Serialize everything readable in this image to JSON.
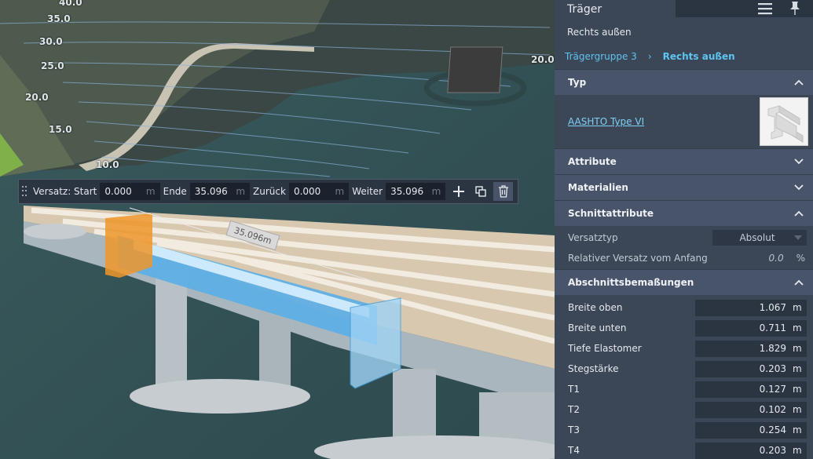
{
  "viewport": {
    "contour_labels": [
      "40.0",
      "35.0",
      "30.0",
      "25.0",
      "20.0",
      "15.0",
      "10.0",
      "20.0"
    ],
    "dimension_label": "35.096m"
  },
  "toolbar": {
    "start_label": "Versatz: Start",
    "start_value": "0.000",
    "end_label": "Ende",
    "end_value": "35.096",
    "back_label": "Zurück",
    "back_value": "0.000",
    "forward_label": "Weiter",
    "forward_value": "35.096",
    "unit": "m",
    "icons": [
      "plus-icon",
      "copy-icon",
      "trash-icon"
    ]
  },
  "panel": {
    "tab_title": "Träger",
    "subtitle": "Rechts außen",
    "breadcrumb": [
      {
        "label": "Trägergruppe 3"
      },
      {
        "label": "Rechts außen"
      }
    ],
    "sections": {
      "type": {
        "title": "Typ",
        "link": "AASHTO Type VI"
      },
      "attributes": {
        "title": "Attribute"
      },
      "materials": {
        "title": "Materialien"
      },
      "cross_section": {
        "title": "Schnittattribute",
        "offset_type_label": "Versatztyp",
        "offset_type_value": "Absolut",
        "relative_offset_label": "Relativer Versatz vom Anfang",
        "relative_offset_value": "0.0",
        "relative_offset_unit": "%"
      },
      "dimensions": {
        "title": "Abschnittsbemaßungen",
        "unit": "m",
        "rows": [
          {
            "label": "Breite oben",
            "value": "1.067"
          },
          {
            "label": "Breite unten",
            "value": "0.711"
          },
          {
            "label": "Tiefe Elastomer",
            "value": "1.829"
          },
          {
            "label": "Stegstärke",
            "value": "0.203"
          },
          {
            "label": "T1",
            "value": "0.127"
          },
          {
            "label": "T2",
            "value": "0.102"
          },
          {
            "label": "T3",
            "value": "0.254"
          },
          {
            "label": "T4",
            "value": "0.203"
          }
        ]
      }
    }
  },
  "colors": {
    "accent": "#5ec4f0",
    "panel_bg": "#3b4657",
    "section_header": "#48546a",
    "girder_selected": "#5aaee8",
    "marker_start": "#f0962a"
  }
}
